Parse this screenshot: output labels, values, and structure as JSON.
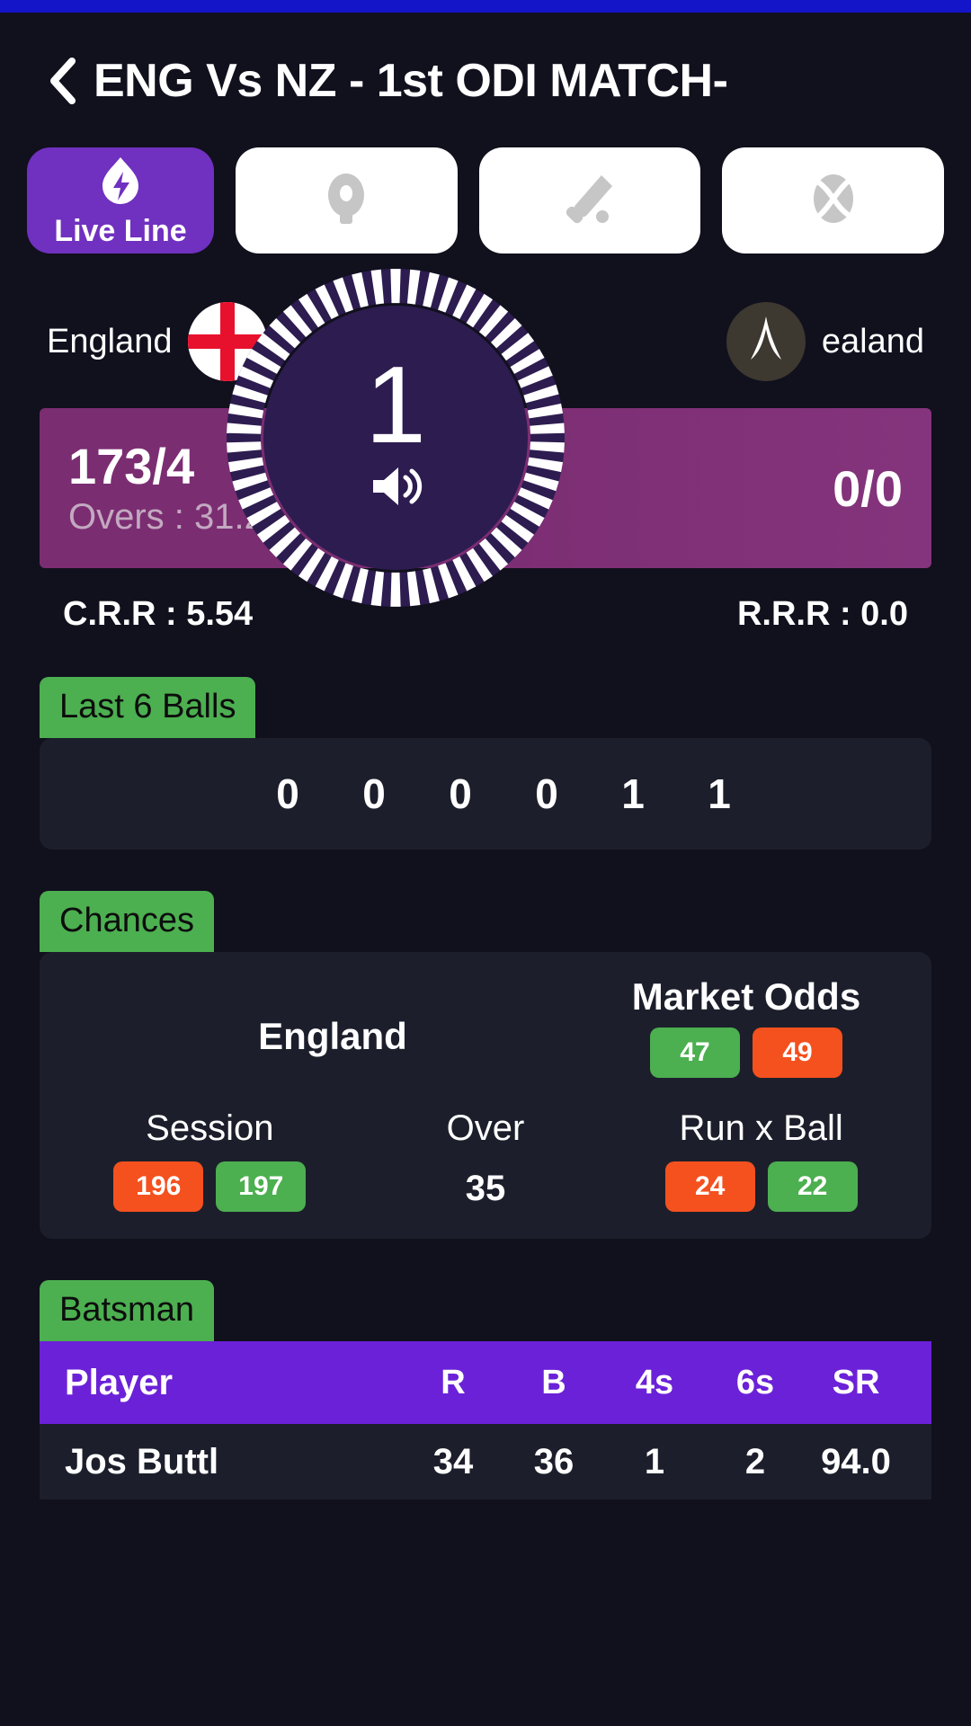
{
  "header": {
    "back_icon": "chevron-left-icon",
    "title": "ENG Vs NZ - 1st ODI MATCH-"
  },
  "tabs": [
    {
      "label": "Live Line",
      "icon": "live-flame-icon",
      "active": true
    },
    {
      "label": "",
      "icon": "player-icon",
      "active": false
    },
    {
      "label": "",
      "icon": "cricket-bat-icon",
      "active": false
    },
    {
      "label": "",
      "icon": "cricket-ball-icon",
      "active": false
    }
  ],
  "teams": {
    "home": {
      "name": "England",
      "flag": "england-flag-icon"
    },
    "away": {
      "name": "ealand",
      "flag": "newzealand-flag-icon"
    }
  },
  "score": {
    "home_score": "173/4",
    "home_overs": "Overs : 31.2",
    "away_score": "0/0",
    "crr": "C.R.R : 5.54",
    "rrr": "R.R.R : 0.0"
  },
  "last_six_balls": {
    "title": "Last 6 Balls",
    "balls": [
      "0",
      "0",
      "0",
      "0",
      "1",
      "1"
    ]
  },
  "chances": {
    "title": "Chances",
    "team": "England",
    "market_odds": {
      "label": "Market Odds",
      "back": "47",
      "lay": "49"
    },
    "session": {
      "label": "Session",
      "no": "196",
      "yes": "197"
    },
    "over": {
      "label": "Over",
      "value": "35"
    },
    "run_x_ball": {
      "label": "Run x Ball",
      "no": "24",
      "yes": "22"
    }
  },
  "batsman": {
    "title": "Batsman",
    "columns": [
      "Player",
      "R",
      "B",
      "4s",
      "6s",
      "SR"
    ],
    "rows": [
      {
        "player": "Jos Buttl",
        "r": "34",
        "b": "36",
        "fours": "1",
        "sixes": "2",
        "sr": "94.0"
      }
    ]
  },
  "overlay_dial": {
    "number": "1",
    "speaker_icon": "speaker-on-icon"
  },
  "colors": {
    "background": "#11101d",
    "accent_purple": "#7030c0",
    "table_header_purple": "#6b21d8",
    "dial_purple": "#2d1c50",
    "score_magenta": "#7b2d72",
    "badge_green": "#4caf50",
    "pill_orange": "#f4511e",
    "statusbar_blue": "#1414c8"
  }
}
